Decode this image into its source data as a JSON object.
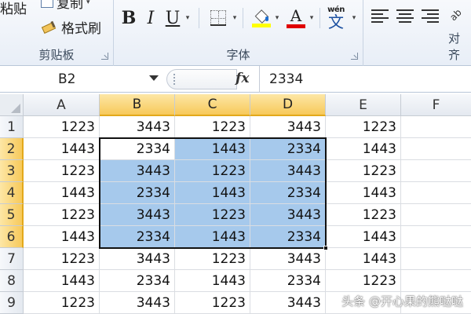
{
  "ribbon": {
    "clipboard": {
      "paste_label": "粘贴",
      "copy_label": "复制",
      "format_painter_label": "格式刷",
      "group_label": "剪贴板"
    },
    "font": {
      "bold_label": "B",
      "italic_label": "I",
      "underline_label": "U",
      "font_color_label": "A",
      "fill_color": "#FFFF00",
      "font_color": "#E00000",
      "phonetic_top": "wén",
      "phonetic_char": "文",
      "group_label": "字体"
    },
    "alignment": {
      "group_label": "对齐"
    }
  },
  "formula_bar": {
    "name_box": "B2",
    "fx_label": "fx",
    "value": "2334"
  },
  "sheet": {
    "columns": [
      "A",
      "B",
      "C",
      "D",
      "E",
      "F"
    ],
    "rows": [
      {
        "num": "1",
        "cells": [
          "1223",
          "3443",
          "1223",
          "3443",
          "1223",
          ""
        ]
      },
      {
        "num": "2",
        "cells": [
          "1443",
          "2334",
          "1443",
          "2334",
          "1443",
          ""
        ]
      },
      {
        "num": "3",
        "cells": [
          "1223",
          "3443",
          "1223",
          "3443",
          "1223",
          ""
        ]
      },
      {
        "num": "4",
        "cells": [
          "1443",
          "2334",
          "1443",
          "2334",
          "1443",
          ""
        ]
      },
      {
        "num": "5",
        "cells": [
          "1223",
          "3443",
          "1223",
          "3443",
          "1223",
          ""
        ]
      },
      {
        "num": "6",
        "cells": [
          "1443",
          "2334",
          "1443",
          "2334",
          "1443",
          ""
        ]
      },
      {
        "num": "7",
        "cells": [
          "1223",
          "3443",
          "1223",
          "3443",
          "1443",
          ""
        ]
      },
      {
        "num": "8",
        "cells": [
          "1443",
          "2334",
          "1443",
          "2334",
          "1223",
          ""
        ]
      },
      {
        "num": "9",
        "cells": [
          "1223",
          "3443",
          "1223",
          "3443",
          "",
          ""
        ]
      }
    ],
    "selection": "B2:D6",
    "active_cell": "B2",
    "highlight_color": "#A6C9EC"
  },
  "watermark": "头条 @开心果的熊哒哒"
}
